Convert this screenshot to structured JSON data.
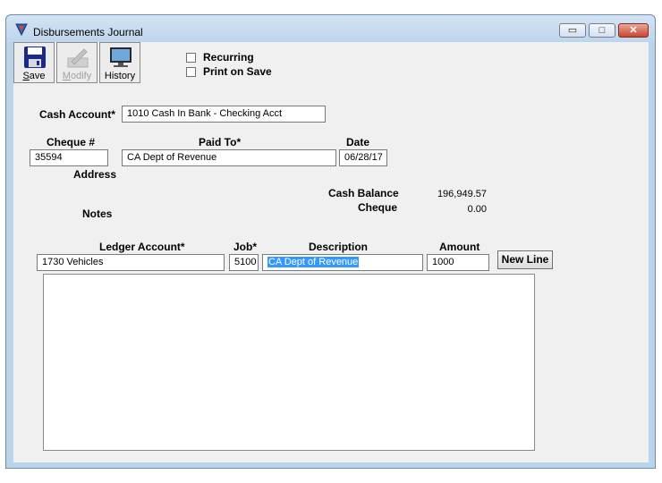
{
  "window": {
    "title": "Disbursements Journal",
    "buttons": {
      "minimize": "▭",
      "maximize": "□",
      "close": "✕"
    }
  },
  "toolbar": {
    "save": {
      "label": "Save",
      "icon": "save-icon",
      "accesskey": "S"
    },
    "modify": {
      "label": "Modify",
      "icon": "modify-icon",
      "accesskey": "M",
      "disabled": true
    },
    "history": {
      "label": "History",
      "icon": "history-icon"
    }
  },
  "options": {
    "recurring": "Recurring",
    "print_on_save": "Print on Save"
  },
  "cash_account": {
    "label": "Cash Account*",
    "value": "1010    Cash In Bank - Checking Acct"
  },
  "cheque_header": {
    "cheque_label": "Cheque #",
    "paid_to_label": "Paid To*",
    "date_label": "Date"
  },
  "cheque": {
    "number": "35594",
    "paid_to": "CA Dept of Revenue",
    "date": "06/28/17"
  },
  "address_label": "Address",
  "notes_label": "Notes",
  "balances": {
    "cash_balance_label": "Cash Balance",
    "cash_balance": "196,949.57",
    "cheque_label": "Cheque",
    "cheque_amount": "0.00"
  },
  "line_header": {
    "ledger": "Ledger Account*",
    "job": "Job*",
    "description": "Description",
    "amount": "Amount"
  },
  "line": {
    "ledger": "1730    Vehicles",
    "job": "5100",
    "description": "CA Dept of Revenue",
    "amount": "1000"
  },
  "new_line_button": "New Line",
  "colors": {
    "selection": "#3399ff",
    "client_bg": "#f0f0f0",
    "frame": "#bcd4ea"
  }
}
